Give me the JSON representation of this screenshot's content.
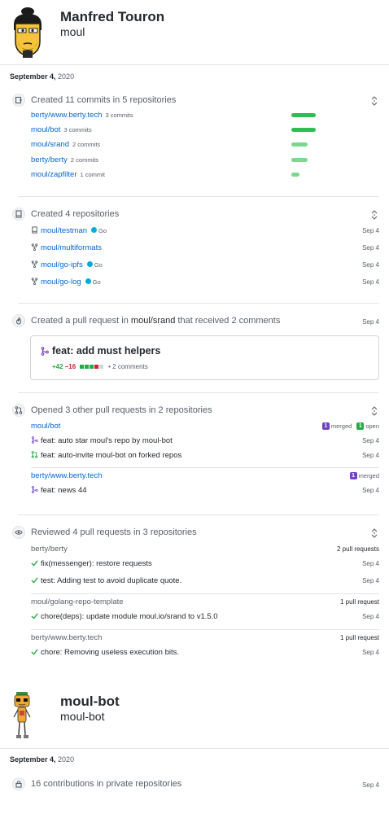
{
  "profiles": [
    {
      "name": "Manfred Touron",
      "login": "moul",
      "date_label": "September 4,",
      "date_year": "2020"
    },
    {
      "name": "moul-bot",
      "login": "moul-bot",
      "date_label": "September 4,",
      "date_year": "2020"
    }
  ],
  "commits": {
    "title": "Created 11 commits in 5 repositories",
    "rows": [
      {
        "repo": "berty/www.berty.tech",
        "count": "3 commits",
        "share": 1.0
      },
      {
        "repo": "moul/bot",
        "count": "3 commits",
        "share": 1.0
      },
      {
        "repo": "moul/srand",
        "count": "2 commits",
        "share": 0.67
      },
      {
        "repo": "berty/berty",
        "count": "2 commits",
        "share": 0.67
      },
      {
        "repo": "moul/zapfilter",
        "count": "1 commit",
        "share": 0.33
      }
    ],
    "bar_colors": {
      "high": "#2cbe4e",
      "mid": "#7bd88f"
    }
  },
  "repos": {
    "title": "Created 4 repositories",
    "rows": [
      {
        "repo": "moul/testman",
        "lang": "Go",
        "date": "Sep 4",
        "kind": "repo-icon"
      },
      {
        "repo": "moul/multiformats",
        "lang": "",
        "date": "Sep 4",
        "kind": "fork-icon"
      },
      {
        "repo": "moul/go-ipfs",
        "lang": "Go",
        "date": "Sep 4",
        "kind": "fork-icon"
      },
      {
        "repo": "moul/go-log",
        "lang": "Go",
        "date": "Sep 4",
        "kind": "fork-icon"
      }
    ]
  },
  "pr_created": {
    "title_prefix": "Created a pull request in",
    "title_repo": "moul/srand",
    "title_suffix": "that received 2 comments",
    "date": "Sep 4",
    "pr_title": "feat: add must helpers",
    "additions": "+42",
    "deletions": "−16",
    "comments": "• 2 comments"
  },
  "pr_opened": {
    "title": "Opened 3 other pull requests in 2 repositories",
    "groups": [
      {
        "repo": "moul/bot",
        "merged_count": "1",
        "merged_label": "merged",
        "open_count": "1",
        "open_label": "open",
        "items": [
          {
            "title": "feat: auto star moul's repo by moul-bot",
            "date": "Sep 4",
            "state": "merged"
          },
          {
            "title": "feat: auto-invite moul-bot on forked repos",
            "date": "Sep 4",
            "state": "open"
          }
        ]
      },
      {
        "repo": "berty/www.berty.tech",
        "merged_count": "1",
        "merged_label": "merged",
        "items": [
          {
            "title": "feat: news 44",
            "date": "Sep 4",
            "state": "merged"
          }
        ]
      }
    ]
  },
  "reviews": {
    "title": "Reviewed 4 pull requests in 3 repositories",
    "groups": [
      {
        "repo": "berty/berty",
        "count": "2 pull requests",
        "items": [
          {
            "title": "fix(messenger): restore requests",
            "date": "Sep 4"
          },
          {
            "title": "test: Adding test to avoid duplicate quote.",
            "date": "Sep 4"
          }
        ]
      },
      {
        "repo": "moul/golang-repo-template",
        "count": "1 pull request",
        "items": [
          {
            "title": "chore(deps): update module moul.io/srand to v1.5.0",
            "date": "Sep 4"
          }
        ]
      },
      {
        "repo": "berty/www.berty.tech",
        "count": "1 pull request",
        "items": [
          {
            "title": "chore: Removing useless execution bits.",
            "date": "Sep 4"
          }
        ]
      }
    ]
  },
  "private": {
    "title": "16 contributions in private repositories",
    "date": "Sep 4"
  },
  "colors": {
    "link": "#0366d6",
    "merged": "#6f42c1",
    "open": "#28a745",
    "go": "#00add8",
    "check": "#28a745"
  }
}
